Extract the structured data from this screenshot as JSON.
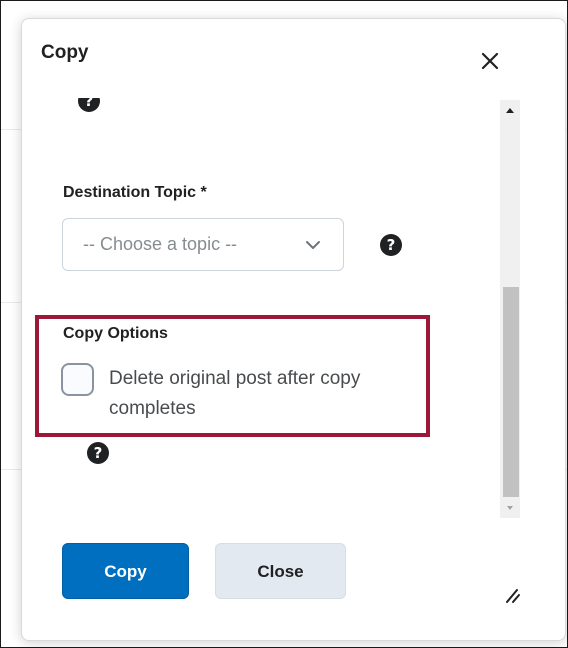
{
  "dialog": {
    "title": "Copy",
    "close_icon": "close-icon"
  },
  "help_icons": {
    "glyph": "?"
  },
  "destination": {
    "label": "Destination Topic *",
    "select_placeholder": "-- Choose a topic --"
  },
  "copy_options": {
    "label": "Copy Options",
    "checkbox_label": "Delete original post after copy completes",
    "checked": false
  },
  "buttons": {
    "copy_label": "Copy",
    "close_label": "Close"
  },
  "colors": {
    "primary": "#006fbf",
    "highlight": "#9d1838",
    "secondary": "#e3e9f1"
  }
}
